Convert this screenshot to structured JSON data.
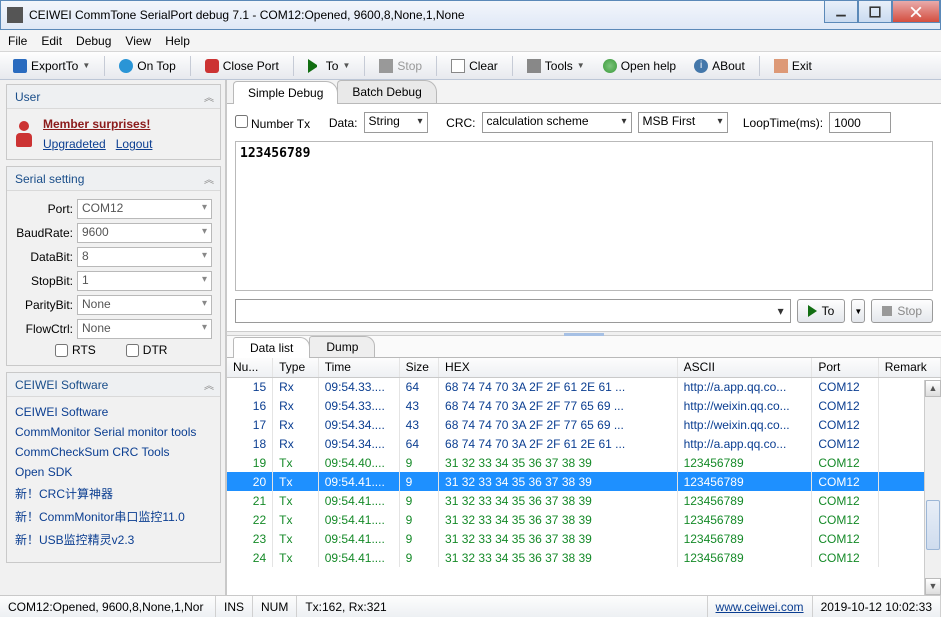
{
  "title": "CEIWEI CommTone SerialPort debug 7.1 - COM12:Opened, 9600,8,None,1,None",
  "menubar": [
    "File",
    "Edit",
    "Debug",
    "View",
    "Help"
  ],
  "toolbar": {
    "export": "ExportTo",
    "ontop": "On Top",
    "close_port": "Close Port",
    "to": "To",
    "stop": "Stop",
    "clear": "Clear",
    "tools": "Tools",
    "open_help": "Open help",
    "about": "ABout",
    "exit": "Exit"
  },
  "left": {
    "user_title": "User",
    "member": "Member surprises!",
    "upgraded": "Upgradeted",
    "logout": "Logout",
    "serial_title": "Serial setting",
    "labels": {
      "port": "Port:",
      "baud": "BaudRate:",
      "databit": "DataBit:",
      "stopbit": "StopBit:",
      "parity": "ParityBit:",
      "flow": "FlowCtrl:"
    },
    "vals": {
      "port": "COM12",
      "baud": "9600",
      "databit": "8",
      "stopbit": "1",
      "parity": "None",
      "flow": "None"
    },
    "rts": "RTS",
    "dtr": "DTR",
    "sw_title": "CEIWEI Software",
    "sw_links": [
      "CEIWEI Software",
      "CommMonitor Serial monitor tools",
      "CommCheckSum CRC Tools",
      "Open SDK",
      "新！CRC计算神器",
      "新！CommMonitor串口监控11.0",
      "新！USB监控精灵v2.3"
    ]
  },
  "tabs": {
    "simple": "Simple Debug",
    "batch": "Batch Debug"
  },
  "ctrl": {
    "number_tx": "Number Tx",
    "data": "Data:",
    "data_val": "String",
    "crc": "CRC:",
    "crc_val": "calculation scheme",
    "msb": "MSB First",
    "loop": "LoopTime(ms):",
    "loop_val": "1000"
  },
  "textarea": "123456789",
  "send": {
    "to": "To",
    "stop": "Stop"
  },
  "lowertabs": {
    "data": "Data list",
    "dump": "Dump"
  },
  "grid": {
    "headers": [
      "Nu...",
      "Type",
      "Time",
      "Size",
      "HEX",
      "ASCII",
      "Port",
      "Remark"
    ],
    "rows": [
      {
        "n": 15,
        "type": "Rx",
        "time": "09:54.33....",
        "size": "64",
        "hex": "68 74 74 70 3A 2F 2F 61 2E 61 ...",
        "ascii": "http://a.app.qq.co...",
        "port": "COM12",
        "cls": "rx"
      },
      {
        "n": 16,
        "type": "Rx",
        "time": "09:54.33....",
        "size": "43",
        "hex": "68 74 74 70 3A 2F 2F 77 65 69 ...",
        "ascii": "http://weixin.qq.co...",
        "port": "COM12",
        "cls": "rx"
      },
      {
        "n": 17,
        "type": "Rx",
        "time": "09:54.34....",
        "size": "43",
        "hex": "68 74 74 70 3A 2F 2F 77 65 69 ...",
        "ascii": "http://weixin.qq.co...",
        "port": "COM12",
        "cls": "rx"
      },
      {
        "n": 18,
        "type": "Rx",
        "time": "09:54.34....",
        "size": "64",
        "hex": "68 74 74 70 3A 2F 2F 61 2E 61 ...",
        "ascii": "http://a.app.qq.co...",
        "port": "COM12",
        "cls": "rx"
      },
      {
        "n": 19,
        "type": "Tx",
        "time": "09:54.40....",
        "size": "9",
        "hex": "31 32 33 34 35 36 37 38 39",
        "ascii": "123456789",
        "port": "COM12",
        "cls": "tx"
      },
      {
        "n": 20,
        "type": "Tx",
        "time": "09:54.41....",
        "size": "9",
        "hex": "31 32 33 34 35 36 37 38 39",
        "ascii": "123456789",
        "port": "COM12",
        "cls": "tx sel"
      },
      {
        "n": 21,
        "type": "Tx",
        "time": "09:54.41....",
        "size": "9",
        "hex": "31 32 33 34 35 36 37 38 39",
        "ascii": "123456789",
        "port": "COM12",
        "cls": "tx"
      },
      {
        "n": 22,
        "type": "Tx",
        "time": "09:54.41....",
        "size": "9",
        "hex": "31 32 33 34 35 36 37 38 39",
        "ascii": "123456789",
        "port": "COM12",
        "cls": "tx"
      },
      {
        "n": 23,
        "type": "Tx",
        "time": "09:54.41....",
        "size": "9",
        "hex": "31 32 33 34 35 36 37 38 39",
        "ascii": "123456789",
        "port": "COM12",
        "cls": "tx"
      },
      {
        "n": 24,
        "type": "Tx",
        "time": "09:54.41....",
        "size": "9",
        "hex": "31 32 33 34 35 36 37 38 39",
        "ascii": "123456789",
        "port": "COM12",
        "cls": "tx"
      }
    ]
  },
  "status": {
    "port": "COM12:Opened, 9600,8,None,1,Nor",
    "ins": "INS",
    "num": "NUM",
    "tx": "Tx:162, Rx:321",
    "url": "www.ceiwei.com",
    "time": "2019-10-12 10:02:33"
  }
}
